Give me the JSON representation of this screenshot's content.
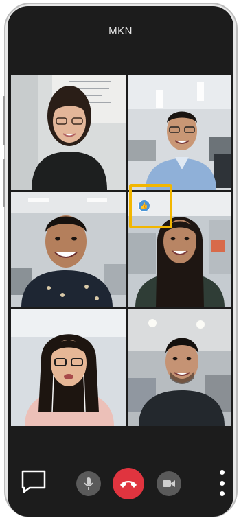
{
  "call": {
    "title": "MKN"
  },
  "reaction": {
    "icon": "thumbs-up-icon",
    "color": "#4a95d6"
  },
  "highlight": {
    "color": "#f2b600"
  },
  "controls": {
    "chat_icon": "chat-icon",
    "mic_icon": "microphone-icon",
    "hangup_icon": "end-call-icon",
    "hangup_color": "#e0343f",
    "video_icon": "video-camera-icon",
    "more_icon": "more-vertical-icon"
  },
  "participants": [
    {
      "tile": "participant-1"
    },
    {
      "tile": "participant-2"
    },
    {
      "tile": "participant-3"
    },
    {
      "tile": "participant-4"
    },
    {
      "tile": "participant-5"
    },
    {
      "tile": "participant-6"
    }
  ]
}
